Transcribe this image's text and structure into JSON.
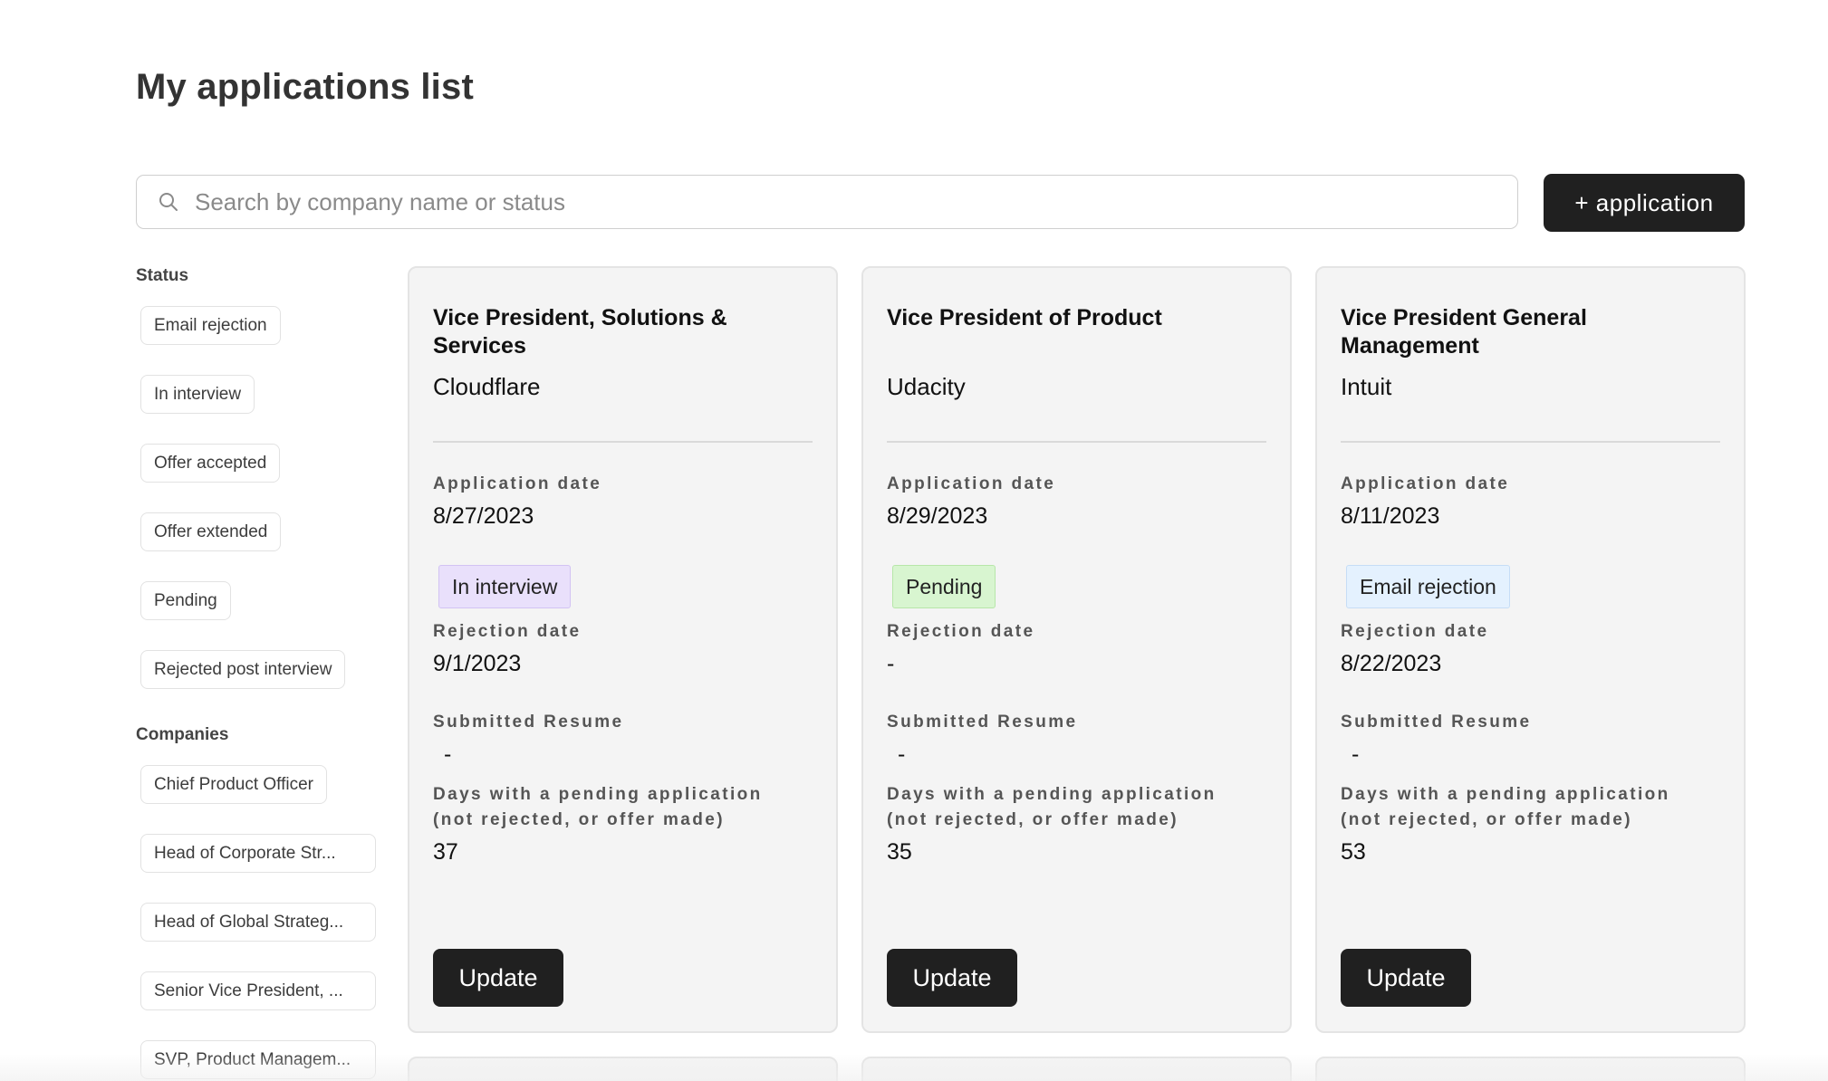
{
  "page": {
    "title": "My applications list"
  },
  "search": {
    "placeholder": "Search by company name or status"
  },
  "actions": {
    "add_application_label": "+ application"
  },
  "sidebar": {
    "status_heading": "Status",
    "status_filters": [
      "Email rejection",
      "In interview",
      "Offer accepted",
      "Offer extended",
      "Pending",
      "Rejected post interview"
    ],
    "companies_heading": "Companies",
    "company_filters": [
      "Chief Product Officer",
      "Head of Corporate Str...",
      "Head of Global Strateg...",
      "Senior Vice President, ...",
      "SVP, Product Managem..."
    ]
  },
  "labels": {
    "application_date": "Application date",
    "rejection_date": "Rejection date",
    "submitted_resume": "Submitted Resume",
    "days_pending_line1": "Days with a pending application",
    "days_pending_line2": "(not rejected, or offer made)",
    "update_button": "Update"
  },
  "cards": [
    {
      "title": "Vice President, Solutions & Services",
      "company": "Cloudflare",
      "application_date": "8/27/2023",
      "status": "In interview",
      "rejection_date": "9/1/2023",
      "submitted_resume": "-",
      "days_pending": "37"
    },
    {
      "title": "Vice President of Product",
      "company": "Udacity",
      "application_date": "8/29/2023",
      "status": "Pending",
      "rejection_date": "-",
      "submitted_resume": "-",
      "days_pending": "35"
    },
    {
      "title": "Vice President General Management",
      "company": "Intuit",
      "application_date": "8/11/2023",
      "status": "Email rejection",
      "rejection_date": "8/22/2023",
      "submitted_resume": "-",
      "days_pending": "53"
    }
  ],
  "colors": {
    "primary_button": "#202020",
    "card_background": "#f4f4f4",
    "badge_in_interview": "#e9e0fb",
    "badge_pending": "#d8f5d0",
    "badge_email_rejection": "#e4f1fe"
  },
  "icons": {
    "search": "search-icon"
  }
}
